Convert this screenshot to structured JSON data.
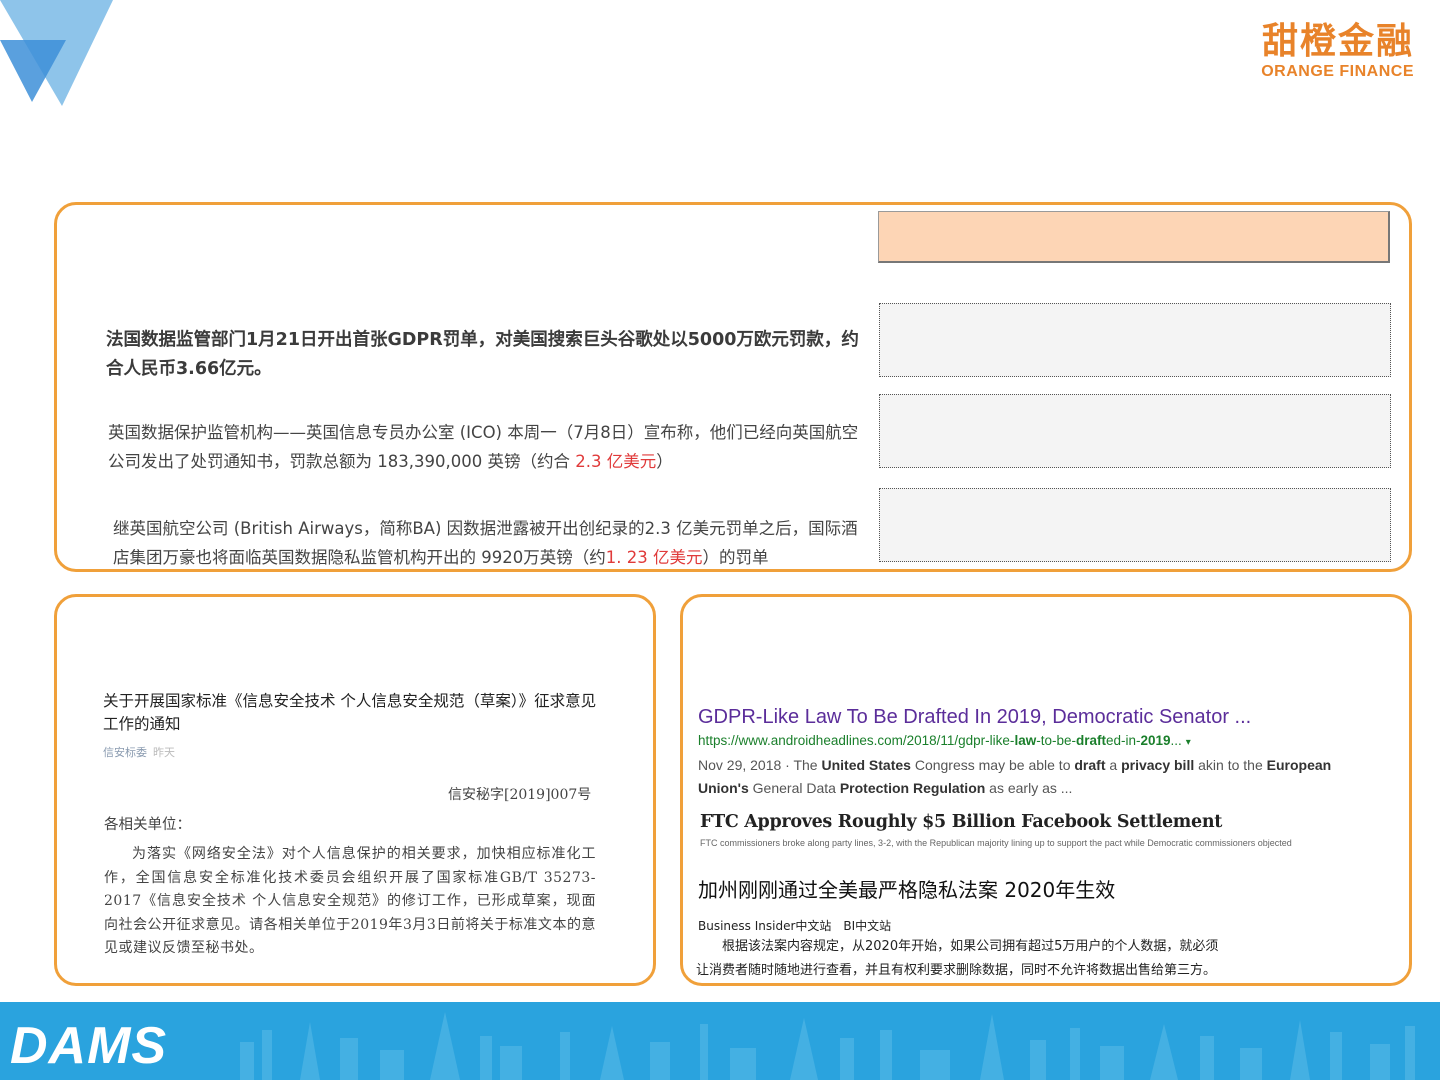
{
  "brand": {
    "logo_cn": "甜橙金融",
    "logo_en": "ORANGE FINANCE",
    "footer_logo": "DAMS"
  },
  "top_panel": {
    "news1": "法国数据监管部门1月21日开出首张GDPR罚单，对美国搜索巨头谷歌处以5000万欧元罚款，约合人民币3.66亿元。",
    "news2_pre": "英国数据保护监管机构——英国信息专员办公室 (ICO) 本周一（7月8日）宣布称，他们已经向英国航空公司发出了处罚通知书，罚款总额为 183,390,000 英镑（约合 ",
    "news2_red": "2.3 亿美元",
    "news2_post": "）",
    "news3_pre": "继英国航空公司 (British Airways，简称BA) 因数据泄露被开出创纪录的2.3 亿美元罚单之后，国际酒店集团万豪也将面临英国数据隐私监管机构开出的 9920万英镑（约",
    "news3_red": "1. 23 亿美元",
    "news3_post": "）的罚单"
  },
  "doc": {
    "title": "关于开展国家标准《信息安全技术 个人信息安全规范（草案）》征求意见工作的通知",
    "source": "信安标委",
    "time": "昨天",
    "ref": "信安秘字[2019]007号",
    "to": "各相关单位：",
    "body": "为落实《网络安全法》对个人信息保护的相关要求，加快相应标准化工作，全国信息安全标准化技术委员会组织开展了国家标准GB/T 35273-2017《信息安全技术 个人信息安全规范》的修订工作，已形成草案，现面向社会公开征求意见。请各相关单位于2019年3月3日前将关于标准文本的意见或建议反馈至秘书处。"
  },
  "search": {
    "title": "GDPR-Like Law To Be Drafted In 2019, Democratic Senator ...",
    "url_1": "https://www.androidheadlines.com/2018/11/gdpr-like-",
    "url_b1": "law",
    "url_2": "-to-be-",
    "url_b2": "draft",
    "url_3": "ed-in-",
    "url_b3": "2019",
    "url_4": "...",
    "url_caret": "▾",
    "snip_date": "Nov 29, 2018 · The ",
    "snip_b1": "United States",
    "snip_2": " Congress may be able to ",
    "snip_b2": "draft",
    "snip_3": " a ",
    "snip_b3": "privacy bill",
    "snip_4": " akin to the ",
    "snip_b4": "European Union's",
    "snip_5": " General Data ",
    "snip_b5": "Protection Regulation",
    "snip_6": " as early as ..."
  },
  "ftc": {
    "title": "FTC Approves Roughly $5 Billion Facebook Settlement",
    "subtitle": "FTC commissioners broke along party lines, 3-2, with the Republican majority lining up to support the pact while Democratic commissioners objected"
  },
  "ca": {
    "title": "加州刚刚通过全美最严格隐私法案 2020年生效",
    "source": "Business Insider中文站　BI中文站",
    "line1": "根据该法案内容规定，从2020年开始，如果公司拥有超过5万用户的个人数据，就必须",
    "line2": "让消费者随时随地进行查看，并且有权利要求删除数据，同时不允许将数据出售给第三方。"
  },
  "colors": {
    "accent": "#f0a03a",
    "logo": "#e8832a",
    "footer": "#2aa3de",
    "triangle_light": "#8ec4ea",
    "triangle_dark": "#3d8fd8",
    "peach": "#fdd5b5",
    "red_text": "#e03a3a"
  }
}
